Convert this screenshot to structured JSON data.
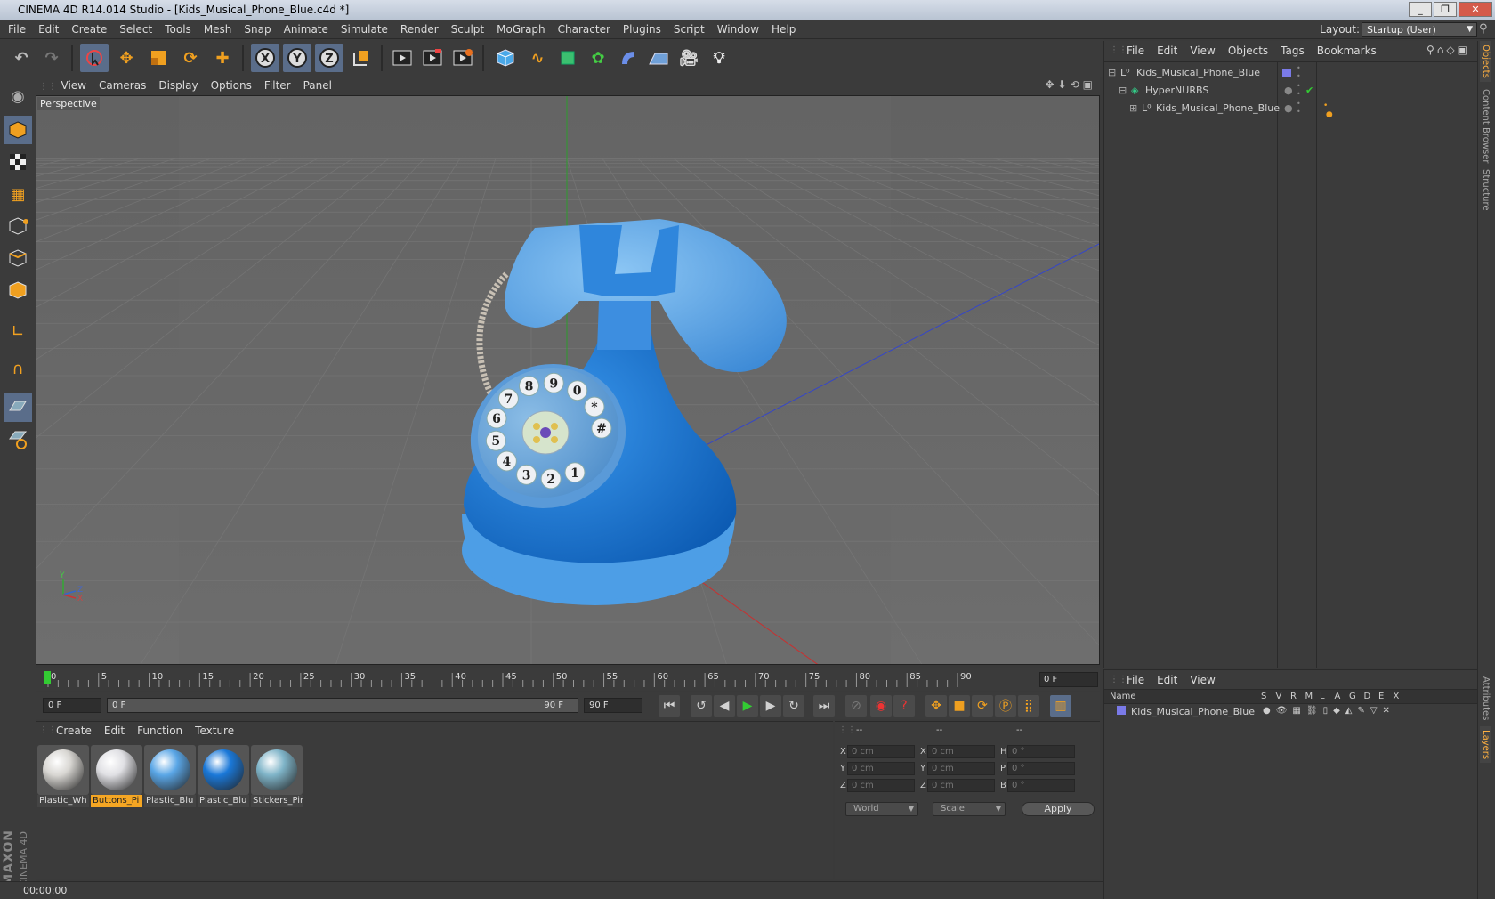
{
  "window": {
    "title": "CINEMA 4D R14.014 Studio - [Kids_Musical_Phone_Blue.c4d *]",
    "min": "_",
    "max": "❐",
    "close": "✕"
  },
  "menubar": {
    "items": [
      "File",
      "Edit",
      "Create",
      "Select",
      "Tools",
      "Mesh",
      "Snap",
      "Animate",
      "Simulate",
      "Render",
      "Sculpt",
      "MoGraph",
      "Character",
      "Plugins",
      "Script",
      "Window",
      "Help"
    ],
    "layout_label": "Layout:",
    "layout_value": "Startup (User)"
  },
  "viewport": {
    "menu": [
      "View",
      "Cameras",
      "Display",
      "Options",
      "Filter",
      "Panel"
    ],
    "camera_label": "Perspective",
    "axis": {
      "y": "Y",
      "x": "X",
      "z": "Z"
    }
  },
  "dial_digits": [
    "1",
    "2",
    "3",
    "4",
    "5",
    "6",
    "7",
    "8",
    "9",
    "0",
    "*",
    "#"
  ],
  "timeline": {
    "ticks": [
      "0",
      "5",
      "10",
      "15",
      "20",
      "25",
      "30",
      "35",
      "40",
      "45",
      "50",
      "55",
      "60",
      "65",
      "70",
      "75",
      "80",
      "85",
      "90"
    ],
    "current_frame": "0 F"
  },
  "anim": {
    "start": "0 F",
    "range_start": "0 F",
    "range_end": "90 F",
    "end": "90 F"
  },
  "materials": {
    "menu": [
      "Create",
      "Edit",
      "Function",
      "Texture"
    ],
    "items": [
      {
        "name": "Plastic_Wh",
        "color": "#d8d6d2",
        "selected": false
      },
      {
        "name": "Buttons_Pi",
        "color": "#e0e0e4",
        "selected": true
      },
      {
        "name": "Plastic_Blu",
        "color": "#5aa6e6",
        "selected": false
      },
      {
        "name": "Plastic_Blu",
        "color": "#1a78d8",
        "selected": false
      },
      {
        "name": "Stickers_Pir",
        "color": "#7fb4c8",
        "selected": false
      }
    ]
  },
  "coords": {
    "headers": [
      "--",
      "--",
      "--"
    ],
    "rows": [
      {
        "a": "X",
        "av": "0 cm",
        "b": "X",
        "bv": "0 cm",
        "c": "H",
        "cv": "0 °"
      },
      {
        "a": "Y",
        "av": "0 cm",
        "b": "Y",
        "bv": "0 cm",
        "c": "P",
        "cv": "0 °"
      },
      {
        "a": "Z",
        "av": "0 cm",
        "b": "Z",
        "bv": "0 cm",
        "c": "B",
        "cv": "0 °"
      }
    ],
    "mode": "World",
    "transform": "Scale",
    "apply": "Apply"
  },
  "status": {
    "time": "00:00:00"
  },
  "objects": {
    "menu": [
      "File",
      "Edit",
      "View",
      "Objects",
      "Tags",
      "Bookmarks"
    ],
    "tree": [
      "Kids_Musical_Phone_Blue",
      "HyperNURBS",
      "Kids_Musical_Phone_Blue"
    ]
  },
  "layers": {
    "menu": [
      "File",
      "Edit",
      "View"
    ],
    "header_name": "Name",
    "columns": [
      "S",
      "V",
      "R",
      "M",
      "L",
      "A",
      "G",
      "D",
      "E",
      "X"
    ],
    "row": "Kids_Musical_Phone_Blue"
  },
  "side_tabs": {
    "objects": "Objects",
    "content": "Content Browser",
    "structure": "Structure",
    "attributes": "Attributes",
    "layers": "Layers"
  },
  "brand": {
    "maxon": "MAXON",
    "c4d": "CINEMA 4D"
  },
  "colors": {
    "phone_blue": "#1a7ad6",
    "phone_light": "#5fa9e8",
    "selection": "#5a6d8a",
    "accent_orange": "#f5a623"
  }
}
